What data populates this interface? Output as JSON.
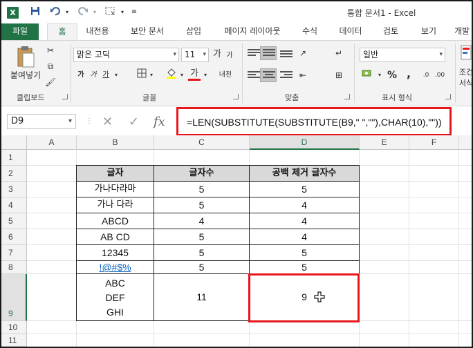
{
  "titlebar": {
    "app_icon": "X",
    "title": "통합 문서1 - Excel",
    "icons": [
      "save-icon",
      "undo-icon",
      "redo-icon",
      "select-objects-icon",
      "customize-icon"
    ]
  },
  "tabs": [
    "파일",
    "홈",
    "내전용",
    "보안 문서",
    "삽입",
    "페이지 레이아웃",
    "수식",
    "데이터",
    "검토",
    "보기",
    "개발"
  ],
  "ribbon": {
    "clipboard": {
      "paste_label": "붙여넣기",
      "group_label": "클립보드"
    },
    "font": {
      "font_name": "맑은 고딕",
      "font_size": "11",
      "grow": "가",
      "shrink": "가",
      "bold": "가",
      "italic": "가",
      "underline": "가",
      "fill": "가",
      "font_color": "가",
      "phonetic": "내천",
      "group_label": "글꼴"
    },
    "alignment": {
      "group_label": "맞춤"
    },
    "number": {
      "format": "일반",
      "percent": "%",
      "comma": ",",
      "group_label": "표시 형식"
    },
    "styles": {
      "cond_label_1": "조건",
      "cond_label_2": "서식"
    }
  },
  "formula_bar": {
    "name_box": "D9",
    "cancel": "✕",
    "enter": "✓",
    "fx": "fx",
    "formula": "=LEN(SUBSTITUTE(SUBSTITUTE(B9,\" \",\"\"),CHAR(10),\"\"))"
  },
  "sheet": {
    "columns": [
      "A",
      "B",
      "C",
      "D",
      "E",
      "F"
    ],
    "rows": [
      "1",
      "2",
      "3",
      "4",
      "5",
      "6",
      "7",
      "8",
      "9",
      "10",
      "11"
    ],
    "selected_cell": "D9",
    "table_headers": [
      "글자",
      "글자수",
      "공백 제거 글자수"
    ],
    "table_rows": [
      [
        "가나다라마",
        "5",
        "5"
      ],
      [
        "가나 다라",
        "5",
        "4"
      ],
      [
        "ABCD",
        "4",
        "4"
      ],
      [
        "AB CD",
        "5",
        "4"
      ],
      [
        "12345",
        "5",
        "5"
      ],
      [
        "!@#$%",
        "5",
        "5"
      ],
      [
        "ABC\nDEF\nGHI",
        "11",
        "9"
      ]
    ],
    "last_row_lines": [
      "ABC",
      "DEF",
      "GHI"
    ]
  }
}
